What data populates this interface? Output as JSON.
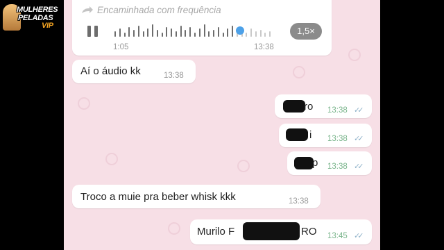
{
  "brand": {
    "logo_line1": "MULHERES",
    "logo_line2": "PELADAS",
    "logo_line3": "VIP"
  },
  "voice_message": {
    "forwarded_label": "Encaminhada com frequência",
    "elapsed": "1:05",
    "time": "13:38",
    "speed": "1,5×",
    "progress": 0.74
  },
  "messages": [
    {
      "direction": "incoming",
      "text": "Aí o áudio kk",
      "time": "13:38"
    },
    {
      "direction": "outgoing",
      "text": "ro",
      "time": "13:38",
      "ticks": "✓✓"
    },
    {
      "direction": "outgoing",
      "text": "i",
      "time": "13:38",
      "ticks": "✓✓"
    },
    {
      "direction": "outgoing",
      "text": "p",
      "time": "13:38",
      "ticks": "✓✓"
    },
    {
      "direction": "incoming",
      "text": "Troco a muie pra beber whisk kkk",
      "time": "13:38"
    },
    {
      "direction": "outgoing",
      "text_start": "Murilo F",
      "text_end": "RO",
      "time": "13:45",
      "ticks": "✓✓"
    }
  ]
}
